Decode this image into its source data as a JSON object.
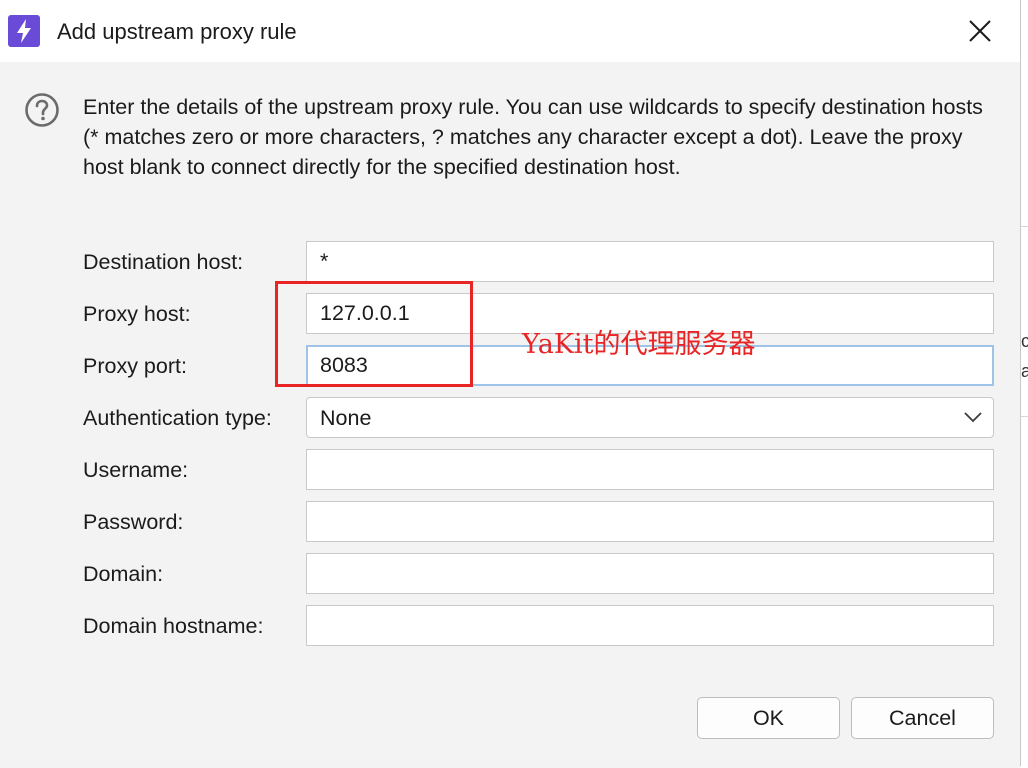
{
  "window": {
    "title": "Add upstream proxy rule",
    "close_icon": "close-icon",
    "app_icon": "lightning-bolt-icon"
  },
  "description": "Enter the details of the upstream proxy rule. You can use wildcards to specify destination hosts (* matches zero or more characters, ? matches any character except a dot). Leave the proxy host blank to connect directly for the specified destination host.",
  "help_icon": "question-circle-icon",
  "form": {
    "destination_host": {
      "label": "Destination host:",
      "value": "*"
    },
    "proxy_host": {
      "label": "Proxy host:",
      "value": "127.0.0.1"
    },
    "proxy_port": {
      "label": "Proxy port:",
      "value": "8083"
    },
    "authentication_type": {
      "label": "Authentication type:",
      "value": "None"
    },
    "username": {
      "label": "Username:",
      "value": ""
    },
    "password": {
      "label": "Password:",
      "value": ""
    },
    "domain": {
      "label": "Domain:",
      "value": ""
    },
    "domain_hostname": {
      "label": "Domain hostname:",
      "value": ""
    }
  },
  "annotation": {
    "text": "YaKit的代理服务器",
    "color": "#e82424"
  },
  "buttons": {
    "ok": "OK",
    "cancel": "Cancel"
  },
  "background_window": {
    "glyph_1": "c",
    "glyph_2": "a"
  },
  "colors": {
    "accent_icon": "#6a4bd8",
    "focus_border": "#9fc3e6",
    "annotation_red": "#e82424"
  }
}
